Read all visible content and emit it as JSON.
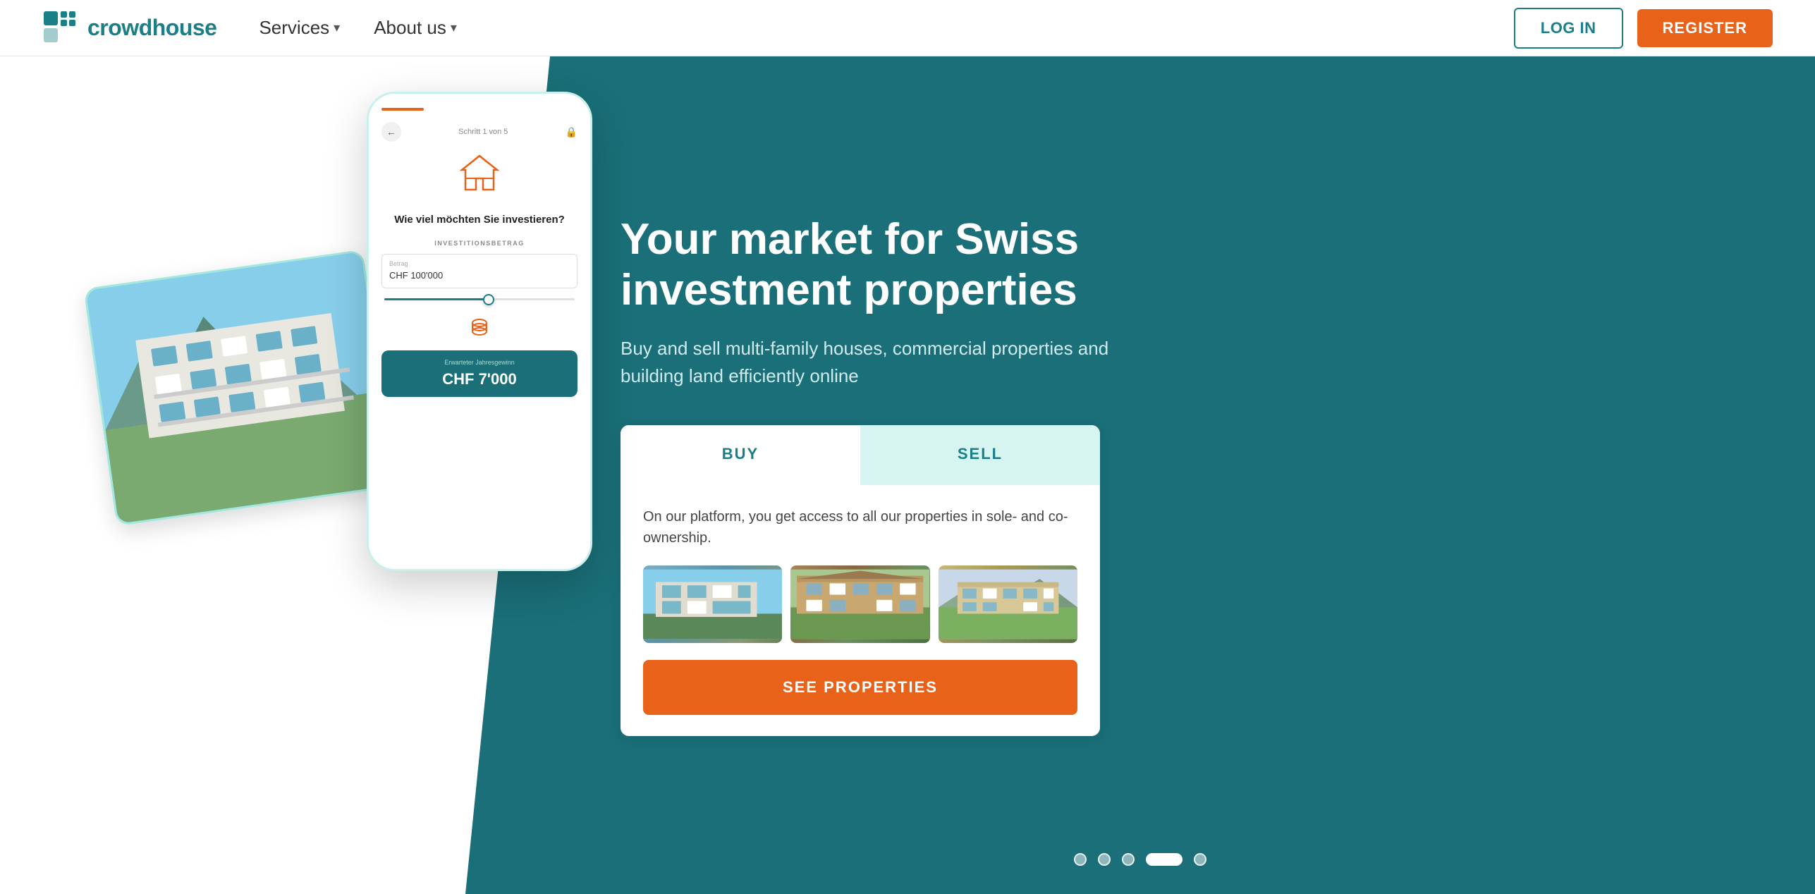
{
  "navbar": {
    "logo_text": "crowdhouse",
    "nav_services": "Services",
    "nav_about": "About us",
    "btn_login": "LOG IN",
    "btn_register": "REGISTER"
  },
  "hero": {
    "title": "Your market for Swiss investment properties",
    "subtitle": "Buy and sell multi-family houses, commercial properties and building land efficiently online"
  },
  "tabs": {
    "buy": "BUY",
    "sell": "SELL"
  },
  "buy_panel": {
    "description": "On our platform, you get access to all our properties in sole- and co-ownership.",
    "cta": "SEE PROPERTIES"
  },
  "phone": {
    "step_text": "Schritt 1 von 5",
    "question": "Wie viel möchten Sie investieren?",
    "investment_label": "INVESTITIONSBETRAG",
    "amount_label": "Betrag",
    "amount_value": "CHF 100'000",
    "result_label": "Erwarteter Jahresgewinn",
    "result_value": "CHF 7'000"
  },
  "dots": {
    "count": 5,
    "active_index": 3
  }
}
